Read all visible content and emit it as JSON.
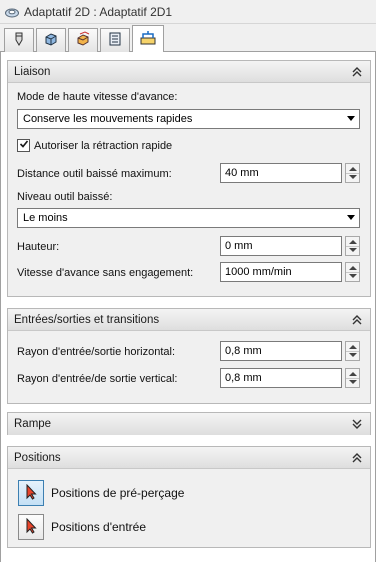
{
  "window": {
    "title": "Adaptatif 2D : Adaptatif 2D1"
  },
  "tabs": [
    {
      "icon": "tool-icon"
    },
    {
      "icon": "geometry-icon"
    },
    {
      "icon": "heights-icon"
    },
    {
      "icon": "passes-icon"
    },
    {
      "icon": "linking-icon",
      "active": true
    }
  ],
  "liaison": {
    "header": "Liaison",
    "mode_label": "Mode de haute vitesse d'avance:",
    "mode_value": "Conserve les mouvements rapides",
    "retract_label": "Autoriser la rétraction rapide",
    "retract_checked": true,
    "max_dist_label": "Distance outil baissé maximum:",
    "max_dist_value": "40 mm",
    "level_label": "Niveau outil baissé:",
    "level_value": "Le moins",
    "height_label": "Hauteur:",
    "height_value": "0 mm",
    "feed_label": "Vitesse d'avance sans engagement:",
    "feed_value": "1000 mm/min"
  },
  "transitions": {
    "header": "Entrées/sorties et transitions",
    "horiz_label": "Rayon d'entrée/sortie horizontal:",
    "horiz_value": "0,8 mm",
    "vert_label": "Rayon d'entrée/de sortie vertical:",
    "vert_value": "0,8 mm"
  },
  "rampe": {
    "header": "Rampe"
  },
  "positions": {
    "header": "Positions",
    "predrill_label": "Positions de pré-perçage",
    "entry_label": "Positions d'entrée"
  },
  "colors": {
    "accent": "#3c7fb1",
    "panel_bg": "#f0f0f0"
  }
}
